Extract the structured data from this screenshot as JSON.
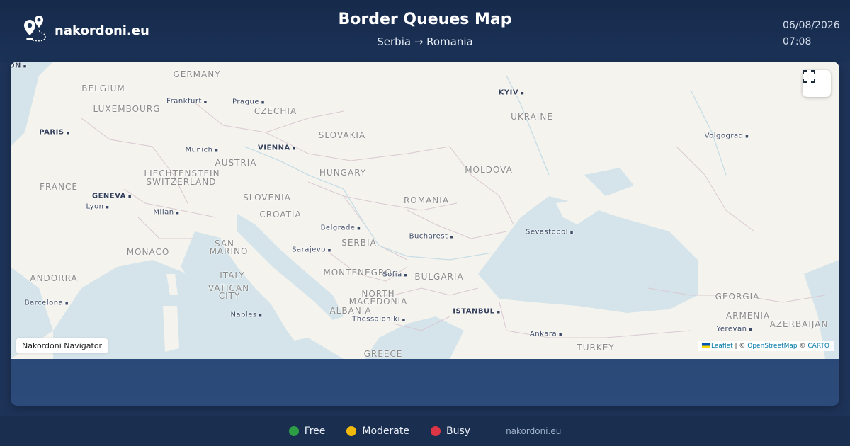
{
  "brand": {
    "name": "nakordoni.eu",
    "logo_icon": "map-pin-route-icon"
  },
  "header": {
    "title": "Border Queues Map",
    "route": "Serbia → Romania",
    "date": "06/08/2026",
    "time": "07:08"
  },
  "map": {
    "fullscreen_icon": "fullscreen-icon",
    "navigator_tag": "Nakordoni Navigator",
    "attribution": {
      "leaflet": "Leaflet",
      "sep1": " | © ",
      "osm": "OpenStreetMap",
      "sep2": " © ",
      "carto": "CARTO"
    },
    "labels": {
      "germany": "GERMANY",
      "belgium": "BELGIUM",
      "luxembourg": "LUXEMBOURG",
      "czechia": "CZECHIA",
      "slovakia": "SLOVAKIA",
      "ukraine": "UKRAINE",
      "france": "FRANCE",
      "austria": "AUSTRIA",
      "liechtenstein": "LIECHTENSTEIN",
      "switzerland": "SWITZERLAND",
      "hungary": "HUNGARY",
      "moldova": "MOLDOVA",
      "slovenia": "SLOVENIA",
      "croatia": "CROATIA",
      "romania": "ROMANIA",
      "monaco": "MONACO",
      "san_marino_1": "SAN",
      "san_marino_2": "MARINO",
      "serbia": "SERBIA",
      "italy": "ITALY",
      "montenegro": "MONTENEGRO",
      "bulgaria": "BULGARIA",
      "andorra": "ANDORRA",
      "vatican_1": "VATICAN",
      "vatican_2": "CITY",
      "north_macedonia_1": "NORTH",
      "north_macedonia_2": "MACEDONIA",
      "albania": "ALBANIA",
      "georgia": "GEORGIA",
      "armenia": "ARMENIA",
      "azerbaijan": "AZERBAIJAN",
      "turkey": "TURKEY",
      "greece": "GREECE",
      "frankfurt": "Frankfurt",
      "prague": "Prague",
      "kyiv": "KYIV",
      "paris": "PARIS",
      "munich": "Munich",
      "vienna": "VIENNA",
      "volgograd": "Volgograd",
      "geneva": "GENEVA",
      "lyon": "Lyon",
      "milan": "Milan",
      "belgrade": "Belgrade",
      "bucharest": "Bucharest",
      "sevastopol": "Sevastopol",
      "sarajevo": "Sarajevo",
      "sofia": "Sofia",
      "barcelona": "Barcelona",
      "naples": "Naples",
      "thessaloniki": "Thessaloniki",
      "istanbul": "ISTANBUL",
      "ankara": "Ankara",
      "yerevan": "Yerevan",
      "london_fragment": "ON"
    }
  },
  "legend": [
    {
      "label": "Free",
      "color": "#2e9e45"
    },
    {
      "label": "Moderate",
      "color": "#f0b90b"
    },
    {
      "label": "Busy",
      "color": "#dc3545"
    }
  ],
  "footer": {
    "site": "nakordoni.eu"
  }
}
